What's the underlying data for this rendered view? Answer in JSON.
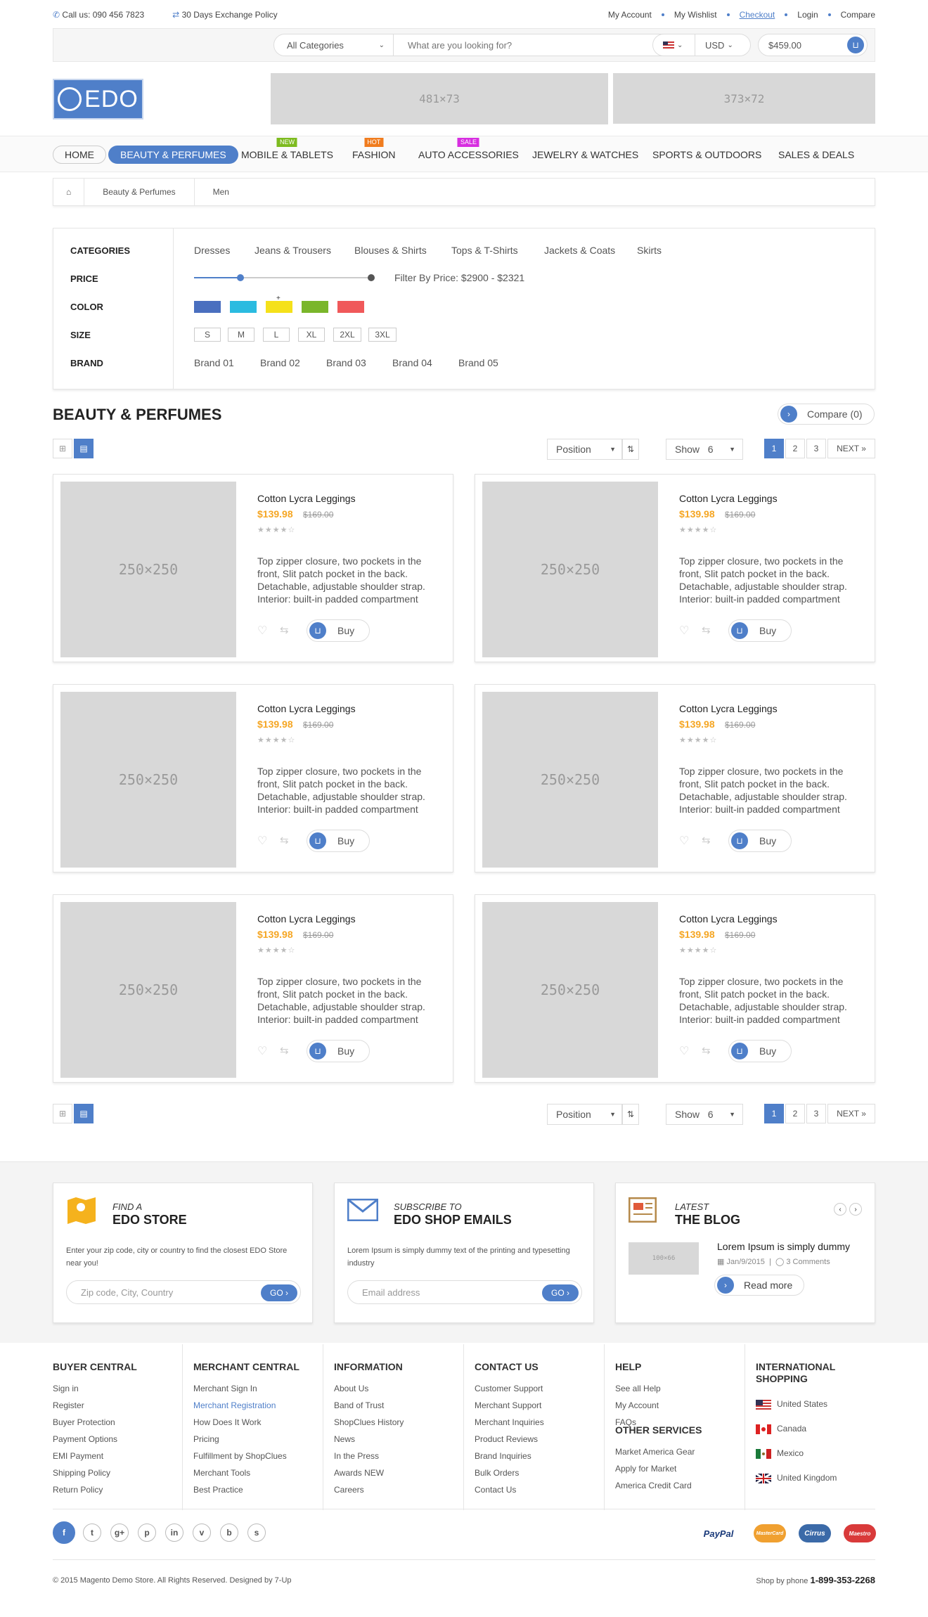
{
  "topbar": {
    "phone": "Call us: 090 456 7823",
    "policy": "30 Days Exchange Policy",
    "links": [
      "My Account",
      "My Wishlist",
      "Checkout",
      "Login",
      "Compare"
    ]
  },
  "search": {
    "category": "All Categories",
    "placeholder": "What are you looking for?",
    "currency": "USD",
    "cart_total": "$459.00"
  },
  "logo": {
    "text": "EDO"
  },
  "banners": [
    "481×73",
    "373×72"
  ],
  "nav": [
    {
      "label": "HOME"
    },
    {
      "label": "BEAUTY & PERFUMES"
    },
    {
      "label": "MOBILE & TABLETS",
      "tag": "NEW",
      "tag_color": "#7dbb1f"
    },
    {
      "label": "FASHION",
      "tag": "HOT",
      "tag_color": "#f07c1e"
    },
    {
      "label": "AUTO ACCESSORIES",
      "tag": "SALE",
      "tag_color": "#d72ee0"
    },
    {
      "label": "JEWELRY & WATCHES"
    },
    {
      "label": "SPORTS & OUTDOORS"
    },
    {
      "label": "SALES & DEALS"
    }
  ],
  "breadcrumb": [
    "Beauty & Perfumes",
    "Men"
  ],
  "filters": {
    "labels": {
      "categories": "CATEGORIES",
      "price": "PRICE",
      "color": "COLOR",
      "size": "SIZE",
      "brand": "BRAND"
    },
    "categories": [
      "Dresses",
      "Jeans & Trousers",
      "Blouses & Shirts",
      "Tops & T-Shirts",
      "Jackets & Coats",
      "Skirts"
    ],
    "price_text": "Filter By Price: $2900  -  $2321",
    "price_slider_fraction": 0.26,
    "colors": [
      "#4a6fbf",
      "#2bbbe0",
      "#f5e11a",
      "#7ab62b",
      "#f0595a"
    ],
    "selected_color_mark": "+",
    "sizes": [
      "S",
      "M",
      "L",
      "XL",
      "2XL",
      "3XL"
    ],
    "brands": [
      "Brand 01",
      "Brand 02",
      "Brand 03",
      "Brand 04",
      "Brand 05"
    ]
  },
  "listing": {
    "title": "BEAUTY & PERFUMES",
    "compare": "Compare (0)",
    "sort": "Position",
    "show_label": "Show",
    "show_value": "6",
    "pages": [
      "1",
      "2",
      "3"
    ],
    "next": "NEXT »"
  },
  "products": [
    {
      "image": "250×250",
      "name": "Cotton Lycra Leggings",
      "price": "$139.98",
      "old_price": "$169.00",
      "rating": 4,
      "desc": "Top zipper closure, two pockets in the front, Slit patch pocket in the back. Detachable, adjustable shoulder strap. Interior: built-in padded compartment",
      "buy": "Buy"
    },
    {
      "image": "250×250",
      "name": "Cotton Lycra Leggings",
      "price": "$139.98",
      "old_price": "$169.00",
      "rating": 4,
      "desc": "Top zipper closure, two pockets in the front, Slit patch pocket in the back. Detachable, adjustable shoulder strap. Interior: built-in padded compartment",
      "buy": "Buy"
    },
    {
      "image": "250×250",
      "name": "Cotton Lycra Leggings",
      "price": "$139.98",
      "old_price": "$169.00",
      "rating": 4,
      "desc": "Top zipper closure, two pockets in the front, Slit patch pocket in the back. Detachable, adjustable shoulder strap. Interior: built-in padded compartment",
      "buy": "Buy"
    },
    {
      "image": "250×250",
      "name": "Cotton Lycra Leggings",
      "price": "$139.98",
      "old_price": "$169.00",
      "rating": 4,
      "desc": "Top zipper closure, two pockets in the front, Slit patch pocket in the back. Detachable, adjustable shoulder strap. Interior: built-in padded compartment",
      "buy": "Buy"
    },
    {
      "image": "250×250",
      "name": "Cotton Lycra Leggings",
      "price": "$139.98",
      "old_price": "$169.00",
      "rating": 4,
      "desc": "Top zipper closure, two pockets in the front, Slit patch pocket in the back. Detachable, adjustable shoulder strap. Interior: built-in padded compartment",
      "buy": "Buy"
    },
    {
      "image": "250×250",
      "name": "Cotton Lycra Leggings",
      "price": "$139.98",
      "old_price": "$169.00",
      "rating": 4,
      "desc": "Top zipper closure, two pockets in the front, Slit patch pocket in the back. Detachable, adjustable shoulder strap. Interior: built-in padded compartment",
      "buy": "Buy"
    }
  ],
  "promo": {
    "store": {
      "kicker": "FIND A",
      "title": "EDO STORE",
      "text": "Enter your zip code, city or country to find the closest EDO Store near you!",
      "placeholder": "Zip code, City, Country",
      "go": "GO ›"
    },
    "subscribe": {
      "kicker": "SUBSCRIBE TO",
      "title": "EDO SHOP EMAILS",
      "text": "Lorem Ipsum is simply dummy text of the printing and typesetting industry",
      "placeholder": "Email address",
      "go": "GO ›"
    },
    "blog": {
      "kicker": "LATEST",
      "title": "THE BLOG",
      "image": "100×66",
      "post_title": "Lorem Ipsum is simply dummy",
      "date": "Jan/9/2015",
      "comments": "3 Comments",
      "read_more": "Read more"
    }
  },
  "footer": {
    "columns": [
      {
        "title": "BUYER CENTRAL",
        "links": [
          "Sign in",
          "Register",
          "Buyer Protection",
          "Payment Options",
          "EMI Payment",
          "Shipping Policy",
          "Return Policy"
        ]
      },
      {
        "title": "MERCHANT CENTRAL",
        "links": [
          "Merchant Sign In",
          "Merchant Registration",
          "How Does It Work",
          "Pricing",
          "Fulfillment by ShopClues",
          "Merchant Tools",
          "Best Practice"
        ]
      },
      {
        "title": "INFORMATION",
        "links": [
          "About Us",
          "Band of Trust",
          "ShopClues History",
          "News",
          "In the Press",
          "Awards NEW",
          "Careers"
        ]
      },
      {
        "title": "CONTACT US",
        "links": [
          "Customer Support",
          "Merchant Support",
          "Merchant Inquiries",
          "Product Reviews",
          "Brand Inquiries",
          "Bulk Orders",
          "Contact Us"
        ]
      },
      {
        "title": "HELP",
        "links": [
          "See all Help",
          "My Account",
          "FAQs"
        ]
      }
    ],
    "other_title": "OTHER SERVICES",
    "other_links": [
      "Market America Gear",
      "Apply for Market",
      "America Credit Card"
    ],
    "intl_title_1": "INTERNATIONAL",
    "intl_title_2": "SHOPPING",
    "countries": [
      "United States",
      "Canada",
      "Mexico",
      "United Kingdom"
    ],
    "social": [
      "f",
      "t",
      "g+",
      "p",
      "in",
      "v",
      "b",
      "s"
    ],
    "payments": [
      "PayPal",
      "MasterCard",
      "Cirrus",
      "Maestro"
    ],
    "copyright": "© 2015 Magento Demo Store. All Rights Reserved. Designed by 7-Up",
    "phone_label": "Shop by phone",
    "phone": "1-899-353-2268"
  },
  "colors": {
    "accent": "#4f7fc9",
    "price": "#f5a623"
  }
}
